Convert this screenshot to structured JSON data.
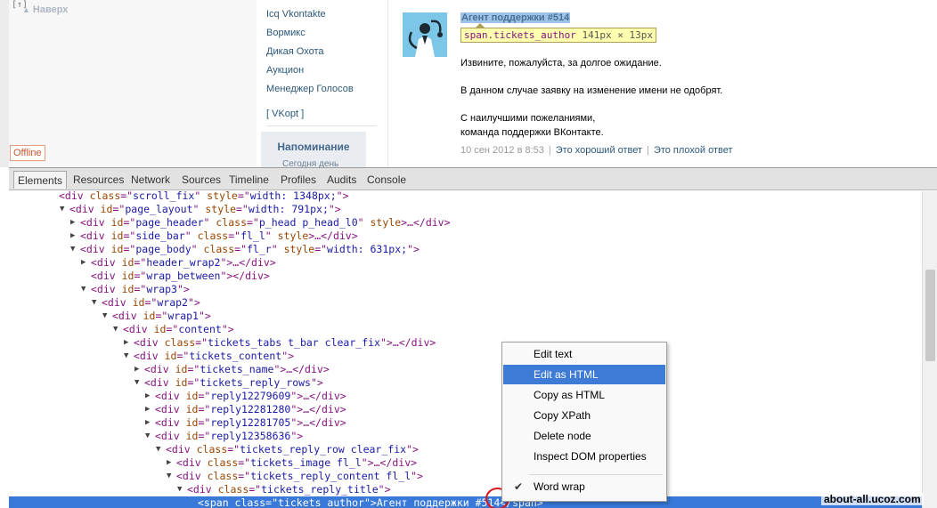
{
  "page": {
    "top_mark": "[↑]",
    "back_up_label": "Наверх",
    "offline_label": "Offline",
    "menu_items": [
      "Icq Vkontakte",
      "Вормикс",
      "Дикая Охота",
      "Аукцион",
      "Менеджер Голосов"
    ],
    "vkopt_label": "[ VKopt ]",
    "reminder_title": "Напоминание",
    "reminder_sub": "Сегодня день"
  },
  "ticket": {
    "author": "Агент поддержки #514",
    "hint_class": "span.tickets_author",
    "hint_size": "141px × 13px",
    "message_lines": [
      "Извините, пожалуйста, за долгое ожидание.",
      "В данном случае заявку на изменение имени не одобрят.",
      "С наилучшими пожеланиями,",
      "команда поддержки ВКонтакте."
    ],
    "date": "10 сен 2012 в 8:53",
    "good_answer": "Это хороший ответ",
    "bad_answer": "Это плохой ответ"
  },
  "devtools": {
    "tabs": [
      "Elements",
      "Resources",
      "Network",
      "Sources",
      "Timeline",
      "Profiles",
      "Audits",
      "Console"
    ],
    "active_tab": "Elements",
    "tree": [
      {
        "indent": 56,
        "tri": "",
        "parts": [
          [
            "t",
            "<div "
          ],
          [
            "n",
            "class"
          ],
          [
            "t",
            "=\""
          ],
          [
            "v",
            "scroll_fix"
          ],
          [
            "t",
            "\" "
          ],
          [
            "n",
            "style"
          ],
          [
            "t",
            "=\""
          ],
          [
            "v",
            "width: 1348px;"
          ],
          [
            "t",
            "\">"
          ]
        ]
      },
      {
        "indent": 68,
        "tri": "▼",
        "parts": [
          [
            "t",
            "<div "
          ],
          [
            "n",
            "id"
          ],
          [
            "t",
            "=\""
          ],
          [
            "v",
            "page_layout"
          ],
          [
            "t",
            "\" "
          ],
          [
            "n",
            "style"
          ],
          [
            "t",
            "=\""
          ],
          [
            "v",
            "width: 791px;"
          ],
          [
            "t",
            "\">"
          ]
        ]
      },
      {
        "indent": 80,
        "tri": "▶",
        "parts": [
          [
            "t",
            "<div "
          ],
          [
            "n",
            "id"
          ],
          [
            "t",
            "=\""
          ],
          [
            "v",
            "page_header"
          ],
          [
            "t",
            "\" "
          ],
          [
            "n",
            "class"
          ],
          [
            "t",
            "=\""
          ],
          [
            "v",
            "p_head p_head_l0"
          ],
          [
            "t",
            "\" "
          ],
          [
            "n",
            "style"
          ],
          [
            "t",
            ">…</div>"
          ]
        ]
      },
      {
        "indent": 80,
        "tri": "▶",
        "parts": [
          [
            "t",
            "<div "
          ],
          [
            "n",
            "id"
          ],
          [
            "t",
            "=\""
          ],
          [
            "v",
            "side_bar"
          ],
          [
            "t",
            "\" "
          ],
          [
            "n",
            "class"
          ],
          [
            "t",
            "=\""
          ],
          [
            "v",
            "fl_l"
          ],
          [
            "t",
            "\" "
          ],
          [
            "n",
            "style"
          ],
          [
            "t",
            ">…</div>"
          ]
        ]
      },
      {
        "indent": 80,
        "tri": "▼",
        "parts": [
          [
            "t",
            "<div "
          ],
          [
            "n",
            "id"
          ],
          [
            "t",
            "=\""
          ],
          [
            "v",
            "page_body"
          ],
          [
            "t",
            "\" "
          ],
          [
            "n",
            "class"
          ],
          [
            "t",
            "=\""
          ],
          [
            "v",
            "fl_r"
          ],
          [
            "t",
            "\" "
          ],
          [
            "n",
            "style"
          ],
          [
            "t",
            "=\""
          ],
          [
            "v",
            "width: 631px;"
          ],
          [
            "t",
            "\">"
          ]
        ]
      },
      {
        "indent": 92,
        "tri": "▶",
        "parts": [
          [
            "t",
            "<div "
          ],
          [
            "n",
            "id"
          ],
          [
            "t",
            "=\""
          ],
          [
            "v",
            "header_wrap2"
          ],
          [
            "t",
            "\">…</div>"
          ]
        ]
      },
      {
        "indent": 92,
        "tri": "",
        "parts": [
          [
            "t",
            "<div "
          ],
          [
            "n",
            "id"
          ],
          [
            "t",
            "=\""
          ],
          [
            "v",
            "wrap_between"
          ],
          [
            "t",
            "\"></div>"
          ]
        ]
      },
      {
        "indent": 92,
        "tri": "▼",
        "parts": [
          [
            "t",
            "<div "
          ],
          [
            "n",
            "id"
          ],
          [
            "t",
            "=\""
          ],
          [
            "v",
            "wrap3"
          ],
          [
            "t",
            "\">"
          ]
        ]
      },
      {
        "indent": 104,
        "tri": "▼",
        "parts": [
          [
            "t",
            "<div "
          ],
          [
            "n",
            "id"
          ],
          [
            "t",
            "=\""
          ],
          [
            "v",
            "wrap2"
          ],
          [
            "t",
            "\">"
          ]
        ]
      },
      {
        "indent": 116,
        "tri": "▼",
        "parts": [
          [
            "t",
            "<div "
          ],
          [
            "n",
            "id"
          ],
          [
            "t",
            "=\""
          ],
          [
            "v",
            "wrap1"
          ],
          [
            "t",
            "\">"
          ]
        ]
      },
      {
        "indent": 128,
        "tri": "▼",
        "parts": [
          [
            "t",
            "<div "
          ],
          [
            "n",
            "id"
          ],
          [
            "t",
            "=\""
          ],
          [
            "v",
            "content"
          ],
          [
            "t",
            "\">"
          ]
        ]
      },
      {
        "indent": 140,
        "tri": "▶",
        "parts": [
          [
            "t",
            "<div "
          ],
          [
            "n",
            "class"
          ],
          [
            "t",
            "=\""
          ],
          [
            "v",
            "tickets_tabs t_bar clear_fix"
          ],
          [
            "t",
            "\">…</div>"
          ]
        ]
      },
      {
        "indent": 140,
        "tri": "▼",
        "parts": [
          [
            "t",
            "<div "
          ],
          [
            "n",
            "id"
          ],
          [
            "t",
            "=\""
          ],
          [
            "v",
            "tickets_content"
          ],
          [
            "t",
            "\">"
          ]
        ]
      },
      {
        "indent": 152,
        "tri": "▶",
        "parts": [
          [
            "t",
            "<div "
          ],
          [
            "n",
            "id"
          ],
          [
            "t",
            "=\""
          ],
          [
            "v",
            "tickets_name"
          ],
          [
            "t",
            "\">…</div>"
          ]
        ]
      },
      {
        "indent": 152,
        "tri": "▼",
        "parts": [
          [
            "t",
            "<div "
          ],
          [
            "n",
            "id"
          ],
          [
            "t",
            "=\""
          ],
          [
            "v",
            "tickets_reply_rows"
          ],
          [
            "t",
            "\">"
          ]
        ]
      },
      {
        "indent": 164,
        "tri": "▶",
        "parts": [
          [
            "t",
            "<div "
          ],
          [
            "n",
            "id"
          ],
          [
            "t",
            "=\""
          ],
          [
            "v",
            "reply12279609"
          ],
          [
            "t",
            "\">…</div>"
          ]
        ]
      },
      {
        "indent": 164,
        "tri": "▶",
        "parts": [
          [
            "t",
            "<div "
          ],
          [
            "n",
            "id"
          ],
          [
            "t",
            "=\""
          ],
          [
            "v",
            "reply12281280"
          ],
          [
            "t",
            "\">…</div>"
          ]
        ]
      },
      {
        "indent": 164,
        "tri": "▶",
        "parts": [
          [
            "t",
            "<div "
          ],
          [
            "n",
            "id"
          ],
          [
            "t",
            "=\""
          ],
          [
            "v",
            "reply12281705"
          ],
          [
            "t",
            "\">…</div>"
          ]
        ]
      },
      {
        "indent": 164,
        "tri": "▼",
        "parts": [
          [
            "t",
            "<div "
          ],
          [
            "n",
            "id"
          ],
          [
            "t",
            "=\""
          ],
          [
            "v",
            "reply12358636"
          ],
          [
            "t",
            "\">"
          ]
        ]
      },
      {
        "indent": 176,
        "tri": "▼",
        "parts": [
          [
            "t",
            "<div "
          ],
          [
            "n",
            "class"
          ],
          [
            "t",
            "=\""
          ],
          [
            "v",
            "tickets_reply_row clear_fix"
          ],
          [
            "t",
            "\">"
          ]
        ]
      },
      {
        "indent": 188,
        "tri": "▶",
        "parts": [
          [
            "t",
            "<div "
          ],
          [
            "n",
            "class"
          ],
          [
            "t",
            "=\""
          ],
          [
            "v",
            "tickets_image fl_l"
          ],
          [
            "t",
            "\">…</div>"
          ]
        ]
      },
      {
        "indent": 188,
        "tri": "▼",
        "parts": [
          [
            "t",
            "<div "
          ],
          [
            "n",
            "class"
          ],
          [
            "t",
            "=\""
          ],
          [
            "v",
            "tickets_reply_content fl_l"
          ],
          [
            "t",
            "\">"
          ]
        ]
      },
      {
        "indent": 200,
        "tri": "▼",
        "parts": [
          [
            "t",
            "<div "
          ],
          [
            "n",
            "class"
          ],
          [
            "t",
            "=\""
          ],
          [
            "v",
            "tickets_reply_title"
          ],
          [
            "t",
            "\">"
          ]
        ]
      },
      {
        "indent": 212,
        "tri": "",
        "selected": true,
        "parts": [
          [
            "t",
            "<span "
          ],
          [
            "n",
            "class"
          ],
          [
            "t",
            "=\""
          ],
          [
            "v",
            "tickets_author"
          ],
          [
            "t",
            "\">Агент поддержки #514</span>"
          ]
        ]
      }
    ]
  },
  "context_menu": {
    "items": [
      "Edit text",
      "Edit as HTML",
      "Copy as HTML",
      "Copy XPath",
      "Delete node",
      "Inspect DOM properties"
    ],
    "highlighted": "Edit as HTML",
    "word_wrap": "Word wrap",
    "word_wrap_checked": true
  },
  "watermark": "about-all.ucoz.com",
  "colors": {
    "selection": "#3879d9",
    "menu_highlight": "#3e7bd6",
    "link": "#2b587a",
    "annotation_circle": "#d9141b"
  }
}
